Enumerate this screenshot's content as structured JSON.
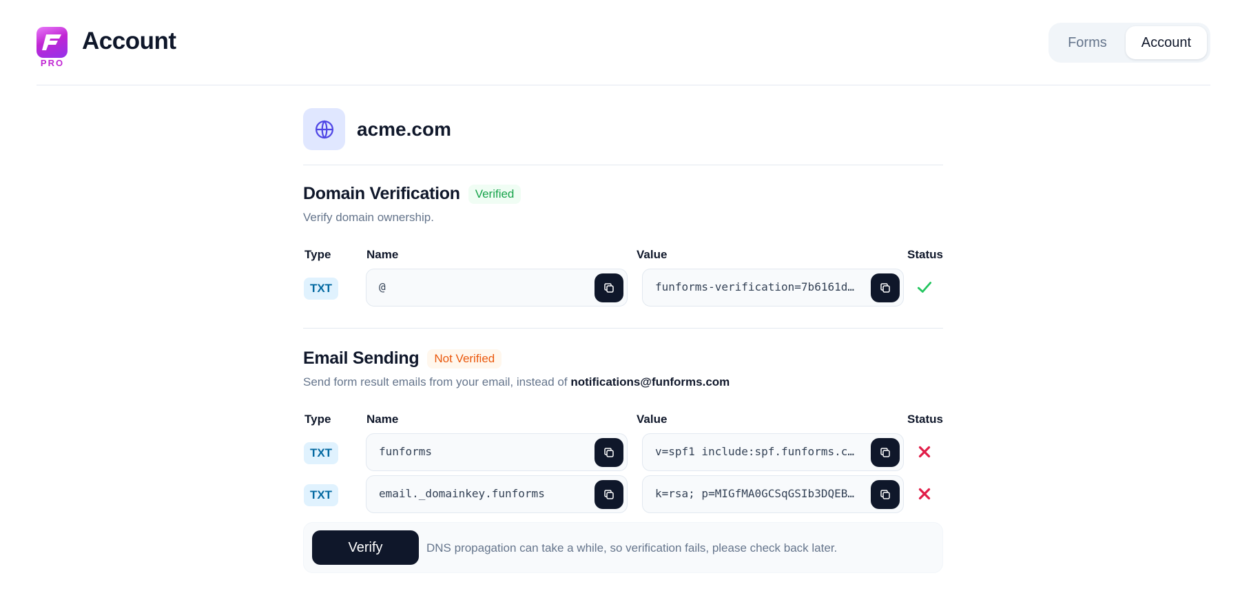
{
  "header": {
    "title": "Account",
    "logo_badge": "PRO",
    "logo_icon": "funforms-logo",
    "nav": [
      {
        "label": "Forms",
        "active": false
      },
      {
        "label": "Account",
        "active": true
      }
    ]
  },
  "domain": {
    "name": "acme.com",
    "icon": "globe-icon"
  },
  "columns": {
    "type": "Type",
    "name": "Name",
    "value": "Value",
    "status": "Status"
  },
  "domain_verification": {
    "title": "Domain Verification",
    "badge": "Verified",
    "description": "Verify domain ownership.",
    "records": [
      {
        "type": "TXT",
        "name": "@",
        "value": "funforms-verification=7b6161da…",
        "status": "verified"
      }
    ]
  },
  "email_sending": {
    "title": "Email Sending",
    "badge": "Not Verified",
    "description_prefix": "Send form result emails from your email, instead of ",
    "description_email": "notifications@funforms.com",
    "records": [
      {
        "type": "TXT",
        "name": "funforms",
        "value": "v=spf1 include:spf.funforms.co…",
        "status": "failed"
      },
      {
        "type": "TXT",
        "name": "email._domainkey.funforms",
        "value": "k=rsa; p=MIGfMA0GCSqGSIb3DQEBA…",
        "status": "failed"
      }
    ]
  },
  "verify": {
    "button_label": "Verify",
    "note": "DNS propagation can take a while, so verification fails, please check back later."
  },
  "colors": {
    "primary": "#0f172a",
    "success": "#22c55e",
    "error": "#e11d48",
    "brand": "#c026d3"
  }
}
